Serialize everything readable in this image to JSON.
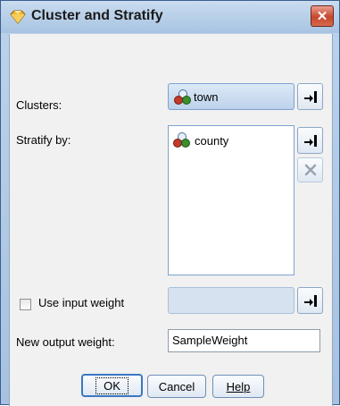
{
  "window": {
    "title": "Cluster and Stratify",
    "close_glyph": "✕"
  },
  "clusters": {
    "label": "Clusters:",
    "field": "town",
    "icon": "nominal-field-icon"
  },
  "stratify": {
    "label": "Stratify by:",
    "items": [
      {
        "name": "county",
        "icon": "nominal-field-icon"
      }
    ]
  },
  "weight": {
    "checkbox_label": "Use input weight",
    "checked": false
  },
  "output_weight": {
    "label": "New output weight:",
    "value": "SampleWeight"
  },
  "buttons": {
    "ok": "OK",
    "cancel": "Cancel",
    "help": "Help"
  },
  "colors": {
    "title_bg": "#bcd3ea",
    "client_bg": "#f1f1f1",
    "close_red": "#c8452d",
    "field_bg": "#bcd2ec"
  }
}
